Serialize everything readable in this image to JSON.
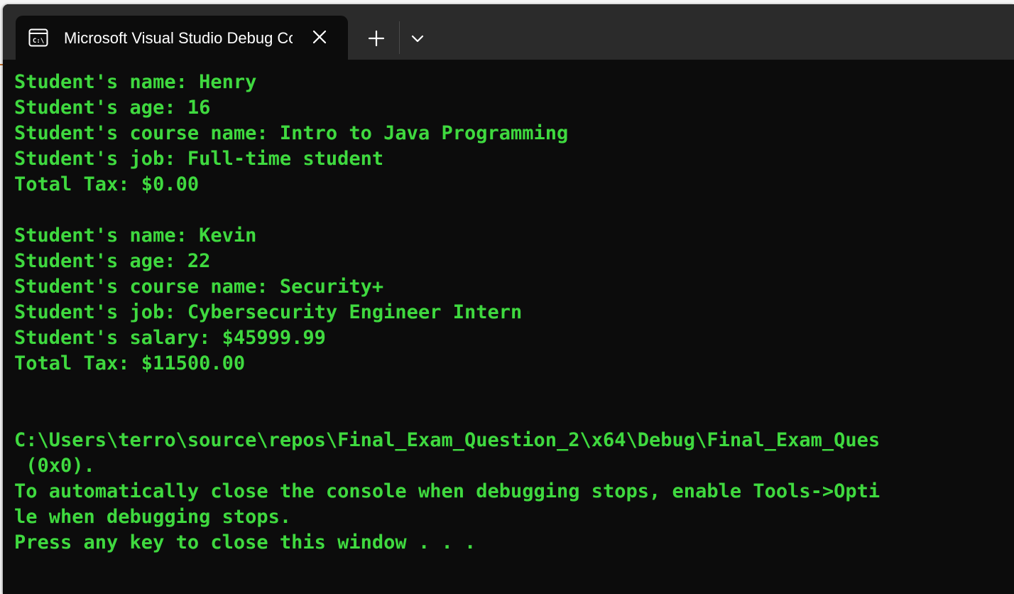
{
  "window": {
    "tab_title": "Microsoft Visual Studio Debug Console",
    "tab_icon": "console-icon",
    "close_icon": "close-icon",
    "new_tab_icon": "plus-icon",
    "dropdown_icon": "chevron-down-icon",
    "colors": {
      "tab_bar": "#2b2b2b",
      "console_background": "#0c0c0c",
      "console_text": "#3fd93f",
      "tab_title": "#ffffff"
    }
  },
  "console": {
    "lines": [
      "Student's name: Henry",
      "Student's age: 16",
      "Student's course name: Intro to Java Programming",
      "Student's job: Full-time student",
      "Total Tax: $0.00",
      "",
      "Student's name: Kevin",
      "Student's age: 22",
      "Student's course name: Security+",
      "Student's job: Cybersecurity Engineer Intern",
      "Student's salary: $45999.99",
      "Total Tax: $11500.00",
      "",
      "",
      "C:\\Users\\terro\\source\\repos\\Final_Exam_Question_2\\x64\\Debug\\Final_Exam_Ques",
      " (0x0).",
      "To automatically close the console when debugging stops, enable Tools->Opti",
      "le when debugging stops.",
      "Press any key to close this window . . ."
    ]
  }
}
